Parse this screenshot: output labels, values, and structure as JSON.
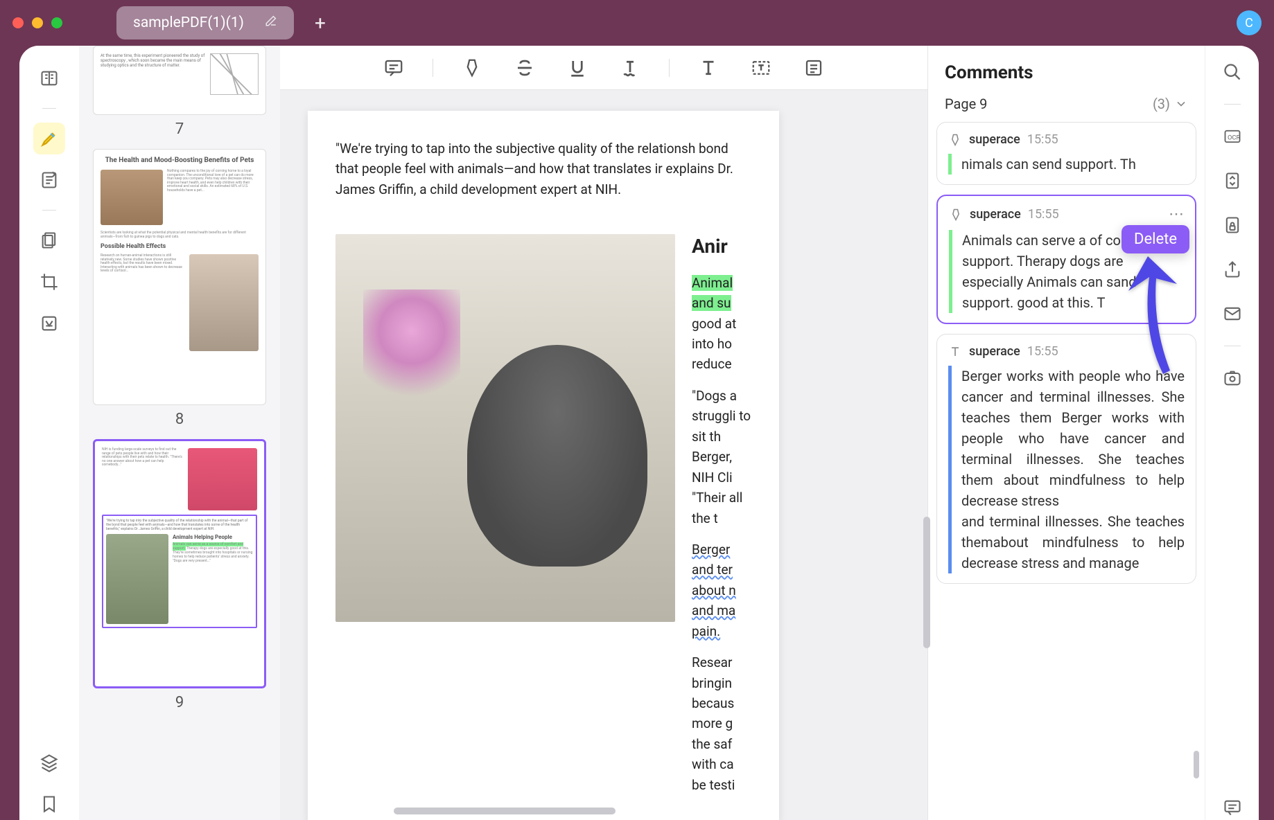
{
  "tab": {
    "title": "samplePDF(1)(1)"
  },
  "avatar": "C",
  "thumbs": [
    {
      "num": "7"
    },
    {
      "num": "8",
      "title": "The Health and Mood-Boosting Benefits of Pets",
      "sub": "Possible Health Effects"
    },
    {
      "num": "9",
      "title": "Animals Helping People"
    }
  ],
  "page": {
    "quote": "\"We're trying to tap into the subjective quality of the relationsh bond that people feel with animals—and how that translates ir explains Dr. James Griffin, a child development expert at NIH.",
    "h2": "Anir",
    "p1a": "Animal",
    "p1b": "and su",
    "p1c": " good at into ho reduce",
    "p2": "\"Dogs a struggli to sit th Berger, NIH Cli \"Their all the t",
    "p3": "Berger and ter about n and ma pain.",
    "p4": "Resear bringin becaus more g the saf with ca be testi"
  },
  "comments": {
    "title": "Comments",
    "pageLabel": "Page 9",
    "count": "(3)",
    "delete": "Delete",
    "items": [
      {
        "user": "superace",
        "time": "15:55",
        "text": "nimals can send support. Th",
        "type": "green"
      },
      {
        "user": "superace",
        "time": "15:55",
        "text": "Animals can serve a of comfort and support. Therapy dogs are especially Animals can sand support. good at this. T",
        "type": "green",
        "selected": true
      },
      {
        "user": "superace",
        "time": "15:55",
        "text": "Berger works with people who have cancer and terminal illnesses. She teaches them Berger works with people who have cancer and terminal illnesses. She teaches them about mindfulness to help decrease stress\nand terminal illnesses.  She teaches  themabout mindfulness to help decrease stress and manage",
        "type": "blue"
      }
    ]
  }
}
